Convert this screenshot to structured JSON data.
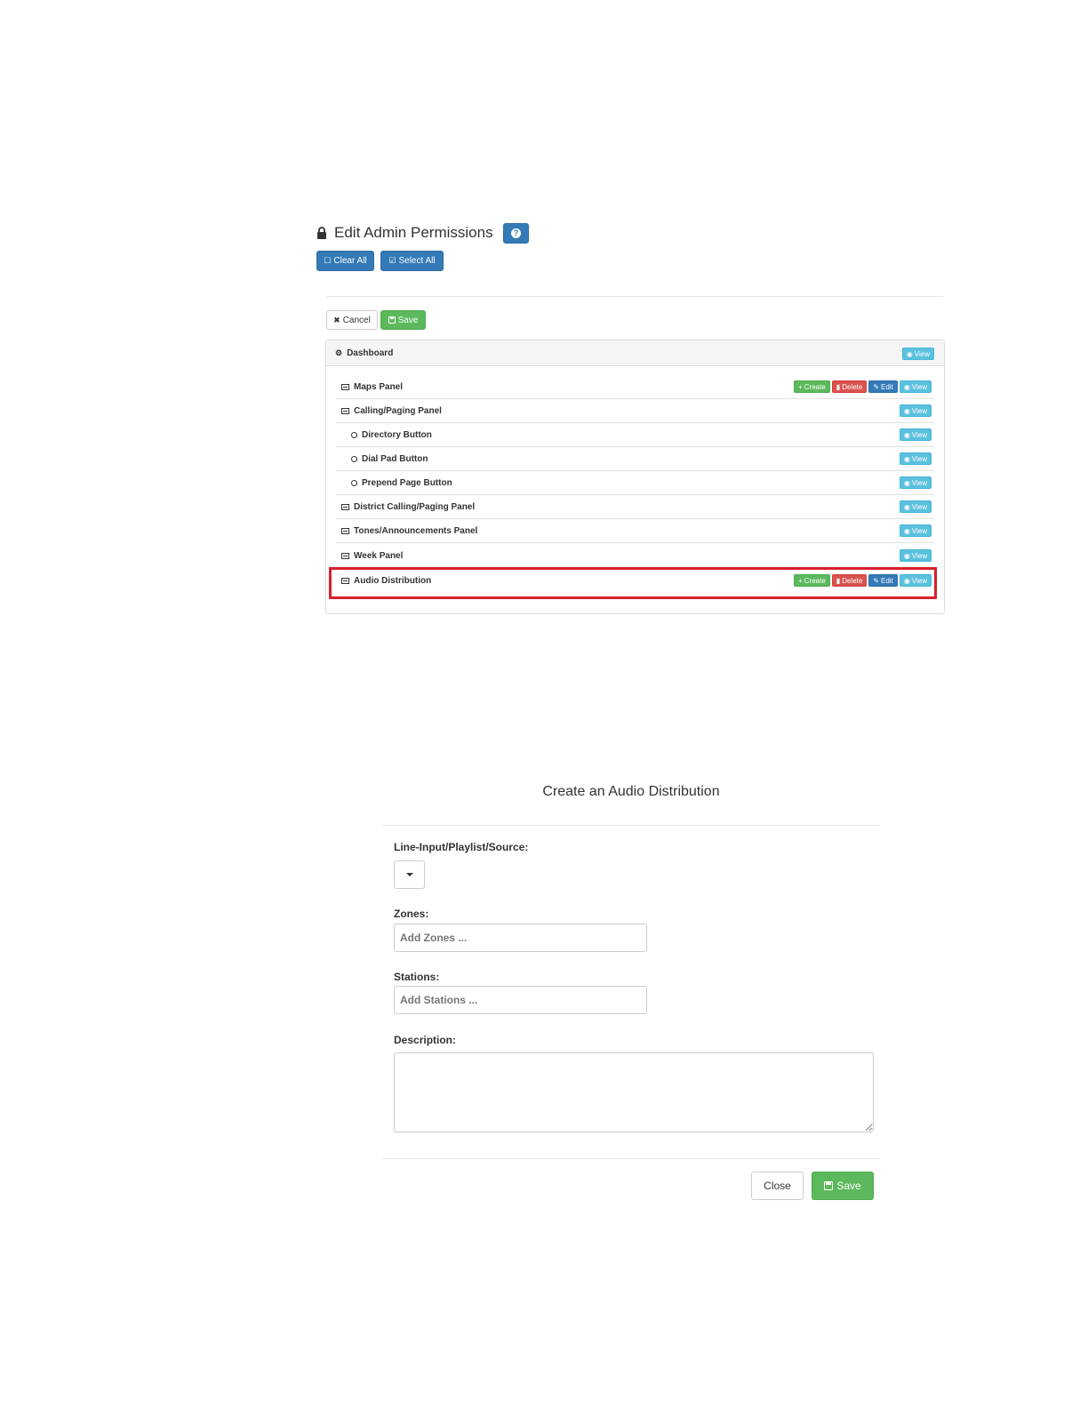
{
  "permissions": {
    "title": "Edit Admin Permissions",
    "help_icon": "?",
    "clear_all": "Clear All",
    "select_all": "Select All",
    "cancel": "Cancel",
    "save": "Save",
    "dashboard": {
      "label": "Dashboard",
      "view": "View"
    },
    "items": [
      {
        "label": "Maps Panel",
        "create": "Create",
        "delete": "Delete",
        "edit": "Edit",
        "view": "View"
      },
      {
        "label": "Calling/Paging Panel",
        "view": "View"
      },
      {
        "label": "Directory Button",
        "view": "View"
      },
      {
        "label": "Dial Pad Button",
        "view": "View"
      },
      {
        "label": "Prepend Page Button",
        "view": "View"
      },
      {
        "label": "District Calling/Paging Panel",
        "view": "View"
      },
      {
        "label": "Tones/Announcements Panel",
        "view": "View"
      },
      {
        "label": "Week Panel",
        "view": "View"
      },
      {
        "label": "Audio Distribution",
        "create": "Create",
        "delete": "Delete",
        "edit": "Edit",
        "view": "View"
      }
    ]
  },
  "modal": {
    "title": "Create an Audio Distribution",
    "source_label": "Line-Input/Playlist/Source:",
    "zones_label": "Zones:",
    "zones_placeholder": "Add Zones ...",
    "stations_label": "Stations:",
    "stations_placeholder": "Add Stations ...",
    "description_label": "Description:",
    "description_value": "",
    "close": "Close",
    "save": "Save"
  },
  "colors": {
    "primary": "#337ab7",
    "success": "#5cb85c",
    "danger": "#d9534f",
    "info": "#5bc0de",
    "highlight": "#d9202a"
  }
}
